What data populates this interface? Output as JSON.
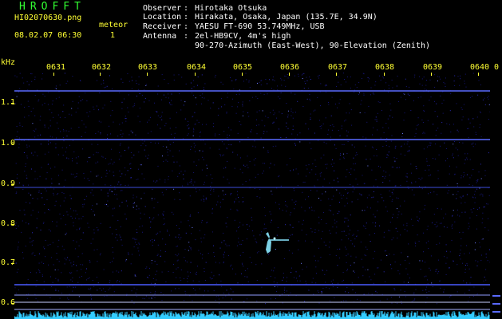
{
  "app": {
    "title": "HROFFT"
  },
  "file": {
    "name": "HI02070630.png",
    "datetime": "08.02.07 06:30"
  },
  "meteor": {
    "label": "meteor",
    "count": "1"
  },
  "info": [
    {
      "key": "Observer",
      "value": "Hirotaka Otsuka"
    },
    {
      "key": "Location",
      "value": "Hirakata, Osaka, Japan (135.7E, 34.9N)"
    },
    {
      "key": "Receiver",
      "value": "YAESU FT-690 53.749MHz, USB"
    },
    {
      "key": "Antenna",
      "value": "2el-HB9CV, 4m's high"
    },
    {
      "key": "",
      "value": "90-270-Azimuth (East-West), 90-Elevation (Zenith)"
    }
  ],
  "axes": {
    "y_unit": "kHz",
    "x_ticks": [
      "0631",
      "0632",
      "0633",
      "0634",
      "0635",
      "0636",
      "0637",
      "0638",
      "0639",
      "0640",
      "0"
    ],
    "y_ticks": [
      "1.1",
      "1.0",
      "0.9",
      "0.8",
      "0.7",
      "0.6"
    ]
  },
  "colors": {
    "title": "#32ff32",
    "labels": "#ffff33",
    "info": "#ffffff",
    "background": "#000000",
    "noise": "#1a1a8c",
    "carrier": "#5a6aff",
    "meteor": "#8ae8ff",
    "baseline": "#33ccff"
  }
}
